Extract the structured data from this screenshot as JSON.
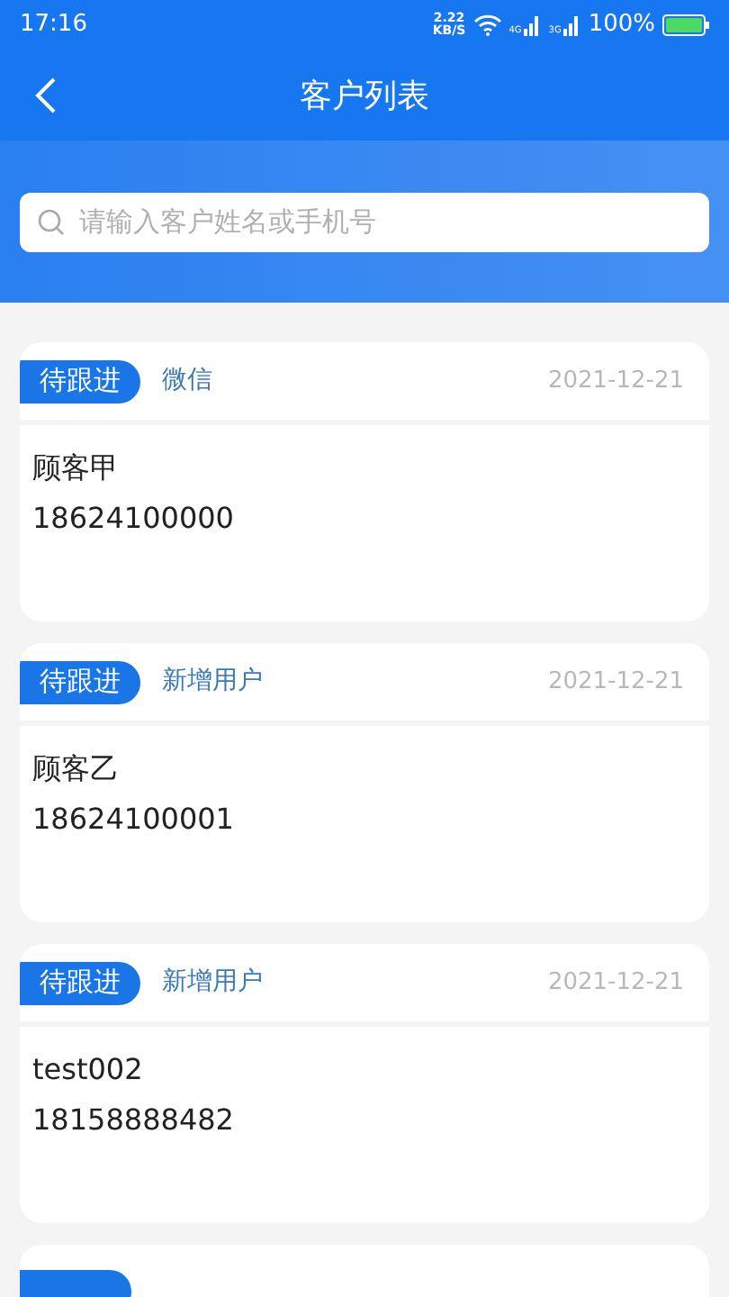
{
  "status_bar": {
    "time": "17:16",
    "speed": "2.22",
    "speed_unit": "KB/S",
    "battery": "100%",
    "network_1": "4G",
    "network_2": "3G"
  },
  "header": {
    "title": "客户列表"
  },
  "search": {
    "placeholder": "请输入客户姓名或手机号"
  },
  "customers": [
    {
      "kind": "full",
      "status": "待跟进",
      "source": "微信",
      "date": "2021-12-21",
      "name": "顾客甲",
      "phone": "18624100000"
    },
    {
      "kind": "full",
      "status": "待跟进",
      "source": "新增用户",
      "date": "2021-12-21",
      "name": "顾客乙",
      "phone": "18624100001"
    },
    {
      "kind": "full",
      "status": "待跟进",
      "source": "新增用户",
      "date": "2021-12-21",
      "name": "test002",
      "phone": "18158888482"
    },
    {
      "kind": "partial"
    }
  ]
}
